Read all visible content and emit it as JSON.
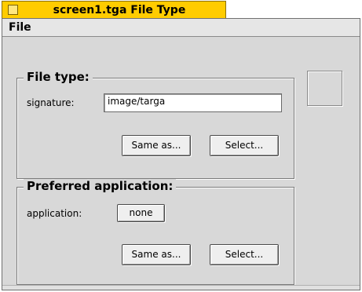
{
  "window": {
    "title": "screen1.tga File Type"
  },
  "menubar": {
    "file_menu": "File"
  },
  "file_type": {
    "legend": "File type:",
    "signature_label": "signature:",
    "signature_value": "image/targa",
    "same_as_label": "Same as...",
    "select_label": "Select..."
  },
  "preferred_app": {
    "legend": "Preferred application:",
    "application_label": "application:",
    "application_value": "none",
    "same_as_label": "Same as...",
    "select_label": "Select..."
  },
  "colors": {
    "tab": "#ffcc00",
    "window_bg": "#d8d8d8"
  }
}
